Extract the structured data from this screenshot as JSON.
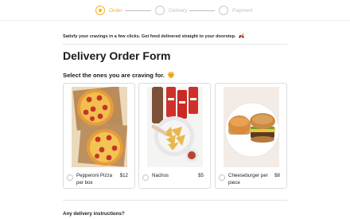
{
  "stepper": {
    "steps": [
      {
        "label": "Order",
        "state": "active"
      },
      {
        "label": "Delivery",
        "state": "inactive"
      },
      {
        "label": "Payment",
        "state": "inactive"
      }
    ]
  },
  "intro": {
    "tagline": "Satisfy your cravings in a few clicks. Get food delivered straight to your doorstep."
  },
  "form": {
    "title": "Delivery Order Form",
    "question": "Select the ones you are craving for.",
    "items": [
      {
        "name": "Pepperoni Pizza per box",
        "price": "$12",
        "icon": "pizza-photo"
      },
      {
        "name": "Nachos",
        "price": "$5",
        "icon": "nachos-photo"
      },
      {
        "name": "Cheeseburger per piece",
        "price": "$8",
        "icon": "burger-photo"
      }
    ],
    "instructions_label": "Any delivery instructions?"
  },
  "colors": {
    "accent": "#f5b21e",
    "border": "#dcdcdc"
  }
}
